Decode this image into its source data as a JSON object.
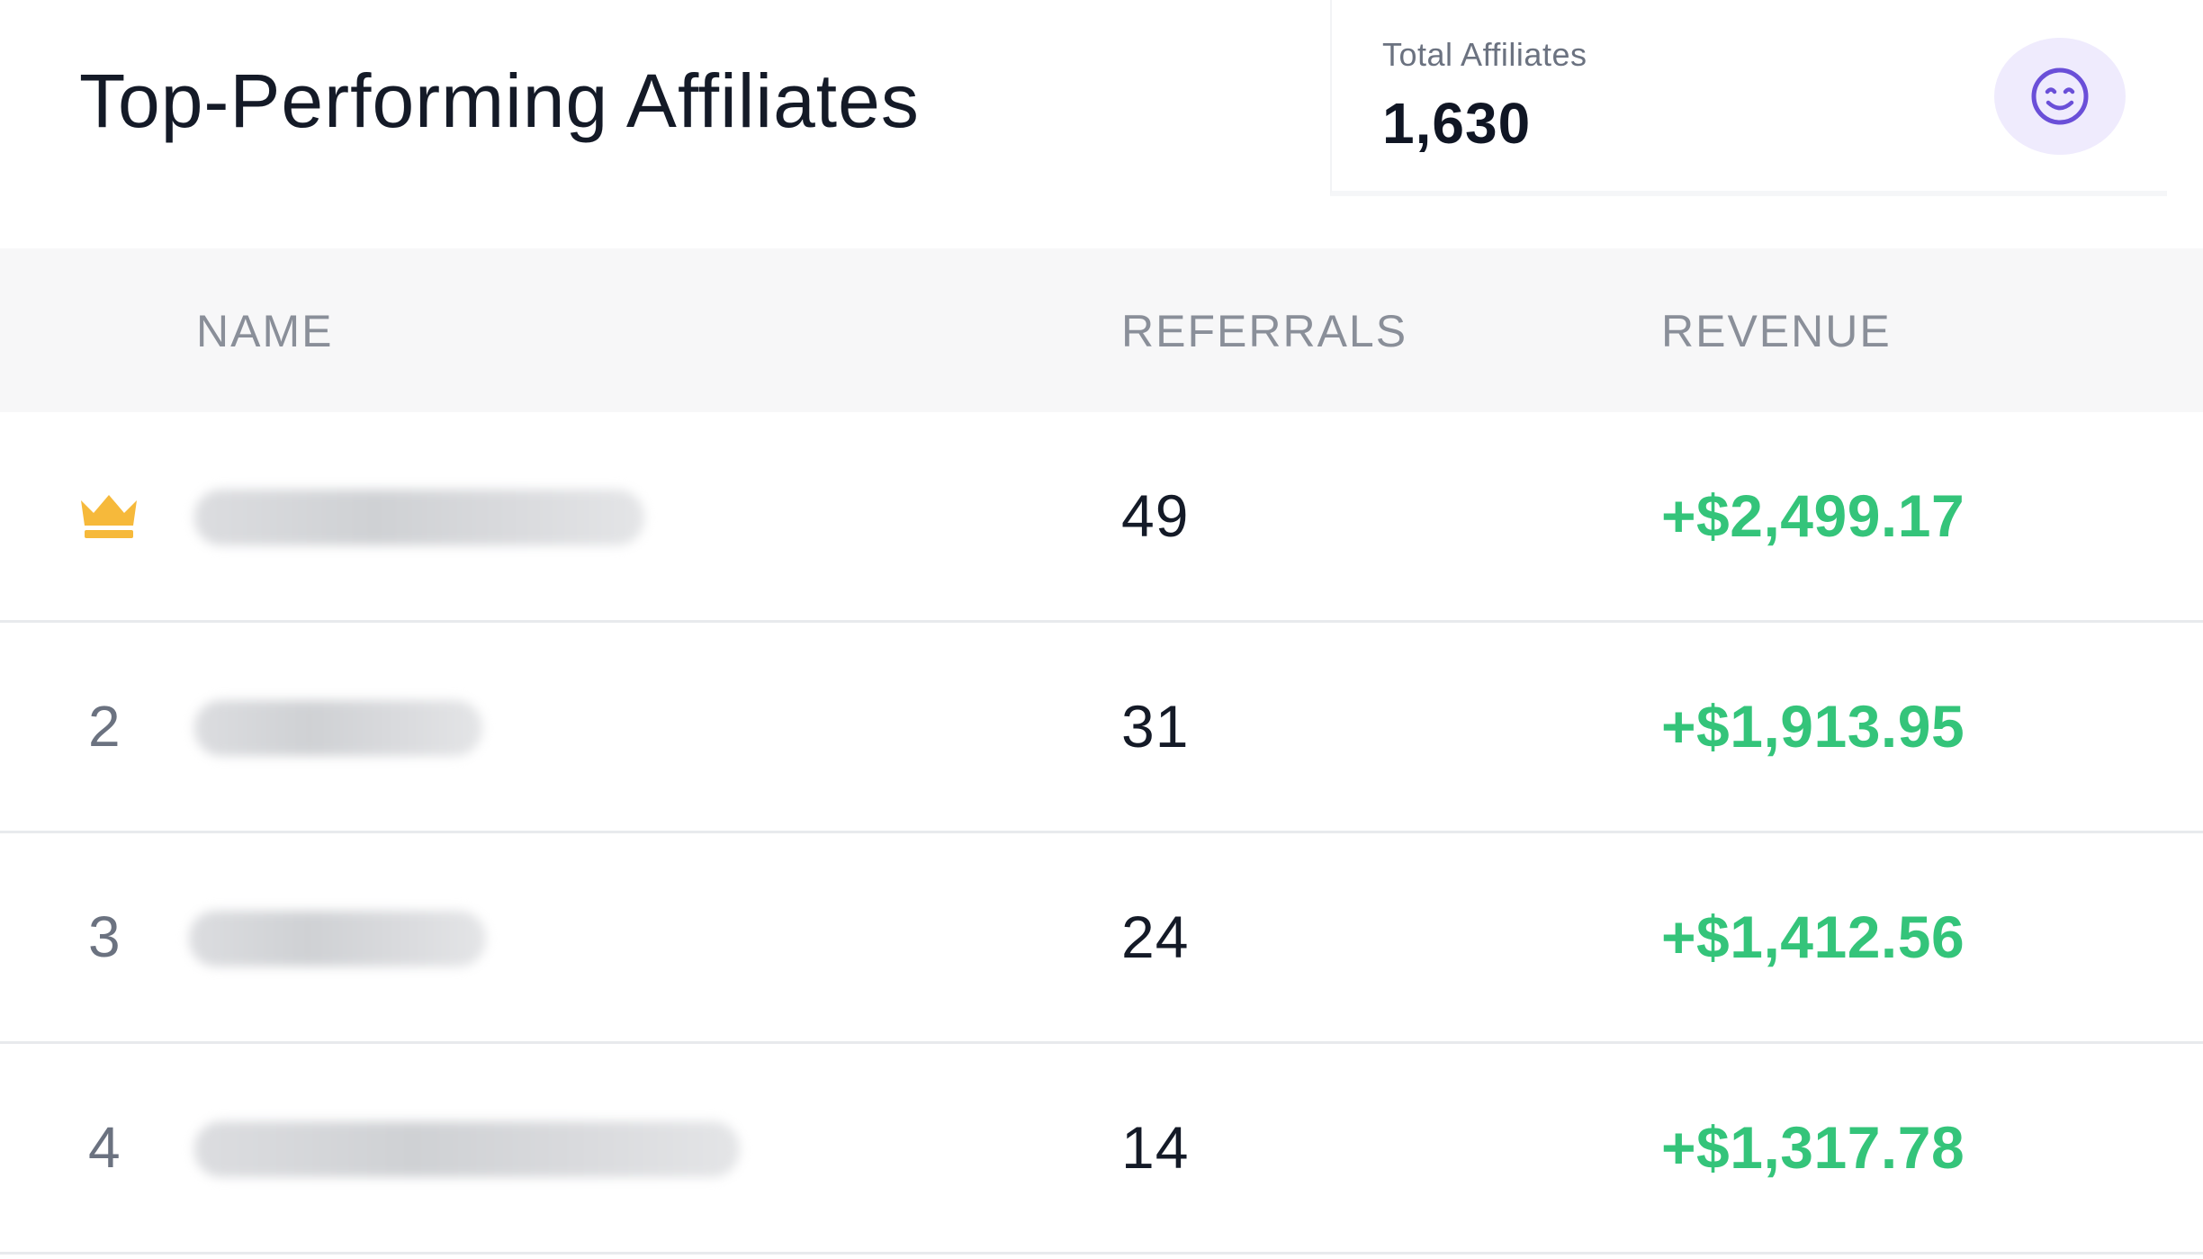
{
  "header": {
    "title": "Top-Performing Affiliates"
  },
  "stat_card": {
    "label": "Total Affiliates",
    "value": "1,630",
    "icon": "smile-icon",
    "icon_color": "#6a4fd8",
    "icon_bg": "#efebfd"
  },
  "table": {
    "columns": [
      "NAME",
      "REFERRALS",
      "REVENUE"
    ],
    "rows": [
      {
        "rank": "",
        "rank_icon": "crown-icon",
        "name": "",
        "referrals": "49",
        "revenue": "+$2,499.17"
      },
      {
        "rank": "2",
        "rank_icon": "",
        "name": "",
        "referrals": "31",
        "revenue": "+$1,913.95"
      },
      {
        "rank": "3",
        "rank_icon": "",
        "name": "",
        "referrals": "24",
        "revenue": "+$1,412.56"
      },
      {
        "rank": "4",
        "rank_icon": "",
        "name": "",
        "referrals": "14",
        "revenue": "+$1,317.78"
      }
    ]
  },
  "colors": {
    "revenue_positive": "#34c47a",
    "crown": "#f6b93b",
    "header_bg": "#f7f7f8"
  }
}
